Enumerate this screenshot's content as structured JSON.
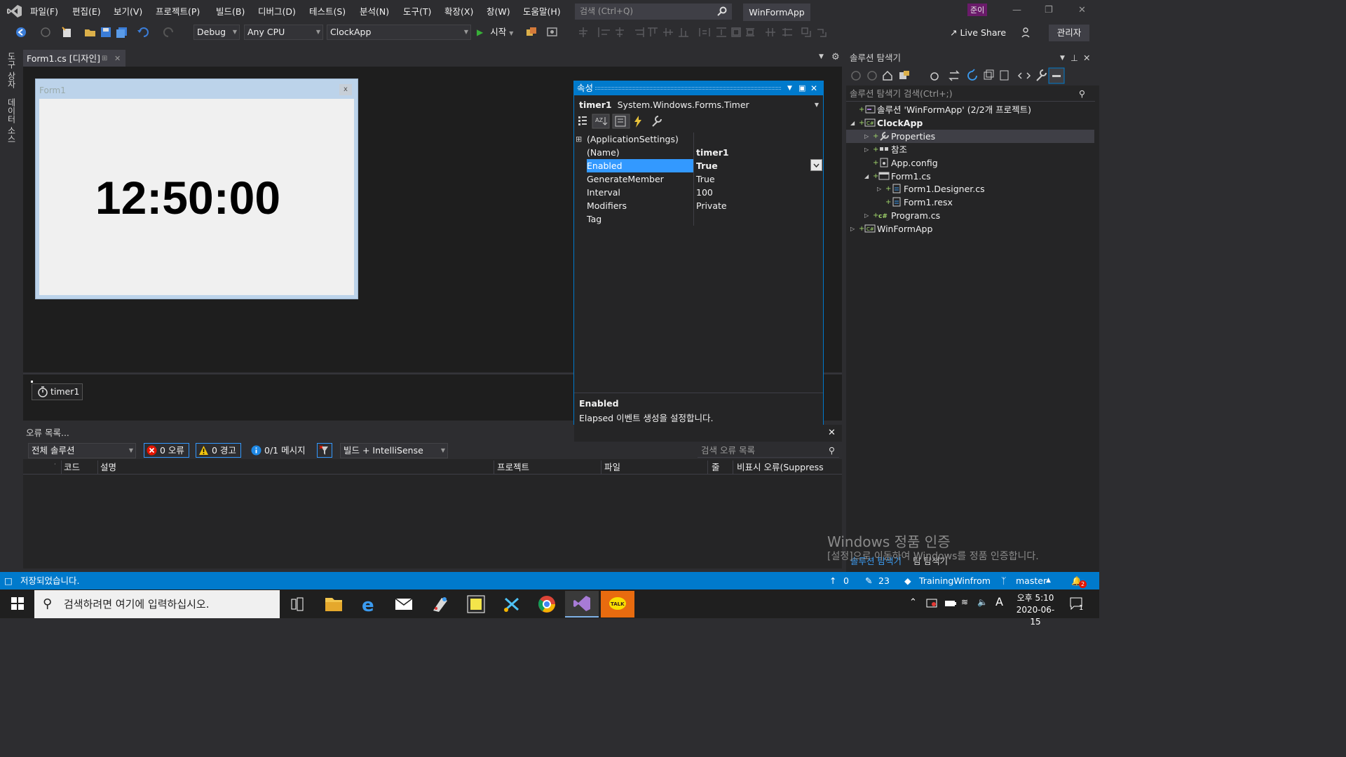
{
  "menu": {
    "items": [
      "파일(F)",
      "편집(E)",
      "보기(V)",
      "프로젝트(P)",
      "빌드(B)",
      "디버그(D)",
      "테스트(S)",
      "분석(N)",
      "도구(T)",
      "확장(X)",
      "창(W)",
      "도움말(H)"
    ],
    "search_placeholder": "검색 (Ctrl+Q)",
    "window_title": "WinFormApp",
    "user_badge": "준이"
  },
  "toolbar": {
    "config": "Debug",
    "platform": "Any CPU",
    "startup_project": "ClockApp",
    "start_label": "시작",
    "live_share": "Live Share",
    "admin": "관리자"
  },
  "side_tabs": [
    "도구 상자",
    "데이터 소스"
  ],
  "document_tab": {
    "label": "Form1.cs [디자인]"
  },
  "form": {
    "title": "Form1",
    "close_glyph": "x",
    "clock_text": "12:50:00"
  },
  "component_tray": {
    "timer_label": "timer1"
  },
  "properties": {
    "title": "속성",
    "object_name": "timer1",
    "object_type": "System.Windows.Forms.Timer",
    "rows": [
      {
        "name": "(ApplicationSettings)",
        "value": "",
        "expander": "⊞"
      },
      {
        "name": "(Name)",
        "value": "timer1",
        "bold": true
      },
      {
        "name": "Enabled",
        "value": "True",
        "bold": true,
        "selected": true
      },
      {
        "name": "GenerateMember",
        "value": "True"
      },
      {
        "name": "Interval",
        "value": "100"
      },
      {
        "name": "Modifiers",
        "value": "Private"
      },
      {
        "name": "Tag",
        "value": ""
      }
    ],
    "desc_title": "Enabled",
    "desc_text": "Elapsed 이벤트 생성을 설정합니다."
  },
  "error_list": {
    "title": "오류 목록...",
    "scope": "전체 솔루션",
    "errors": "0 오류",
    "warnings": "0 경고",
    "messages": "0/1 메시지",
    "source": "빌드 + IntelliSense",
    "search_placeholder": "검색 오류 목록",
    "columns": [
      "코드",
      "설명",
      "프로젝트",
      "파일",
      "줄",
      "비표시 오류(Suppress"
    ]
  },
  "solution_explorer": {
    "title": "솔루션 탐색기",
    "search_placeholder": "솔루션 탐색기 검색(Ctrl+;)",
    "tree": [
      {
        "label": "솔루션 'WinFormApp' (2/2개 프로젝트)"
      },
      {
        "label": "ClockApp"
      },
      {
        "label": "Properties"
      },
      {
        "label": "참조"
      },
      {
        "label": "App.config"
      },
      {
        "label": "Form1.cs"
      },
      {
        "label": "Form1.Designer.cs"
      },
      {
        "label": "Form1.resx"
      },
      {
        "label": "Program.cs"
      },
      {
        "label": "WinFormApp"
      }
    ],
    "bottom_tabs": [
      "솔루션 탐색기",
      "팀 탐색기"
    ]
  },
  "watermark": {
    "title": "Windows 정품 인증",
    "subtitle": "[설정]으로 이동하여 Windows를 정품 인증합니다."
  },
  "statusbar": {
    "message": "저장되었습니다.",
    "up_count": "0",
    "pencil_count": "23",
    "repo": "TrainingWinfrom",
    "branch": "master",
    "notif_count": "2"
  },
  "taskbar": {
    "search_placeholder": "검색하려면 여기에 입력하십시오.",
    "time": "오후 5:10",
    "date": "2020-06-15",
    "ime": "A",
    "notif": "1",
    "kakao_label": "TALK"
  },
  "colors": {
    "accent": "#007acc",
    "background": "#2d2d30",
    "editor": "#1e1e1e"
  }
}
